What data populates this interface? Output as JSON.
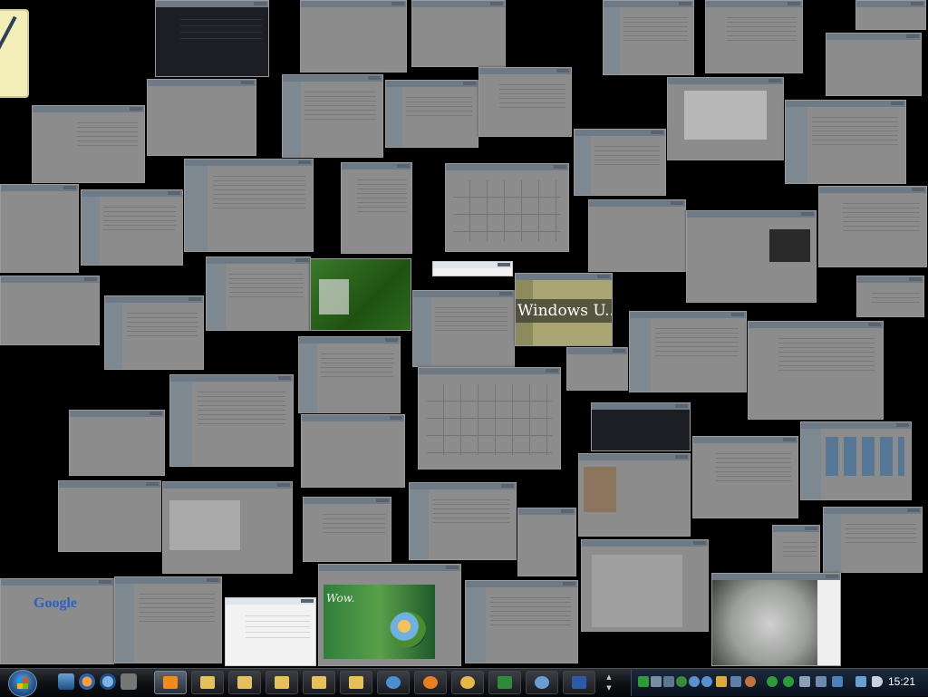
{
  "highlighted_window": {
    "title": "Windows U..."
  },
  "google_window": {
    "logo_text": "Google"
  },
  "wow_window": {
    "tagline": "Wow."
  },
  "taskbar": {
    "start_label": "Start",
    "clock": "15:21",
    "quick_launch": [
      "show-desktop",
      "firefox",
      "internet-explorer",
      "camera"
    ],
    "buttons": [
      "media-player",
      "folder",
      "folder",
      "folder",
      "folder",
      "folder",
      "internet-explorer",
      "firefox",
      "clock",
      "excel",
      "network",
      "word"
    ]
  },
  "tray_icons": [
    "green",
    "network",
    "network",
    "user",
    "globe",
    "globe",
    "clock",
    "chat",
    "sound",
    "green",
    "green",
    "phone",
    "printer",
    "monitor",
    "network",
    "volume"
  ],
  "colors": {
    "desktop": "#000000",
    "taskbar": "#0f1114",
    "window_thumb": "#8c8c8c",
    "highlight": "#a9a674"
  }
}
